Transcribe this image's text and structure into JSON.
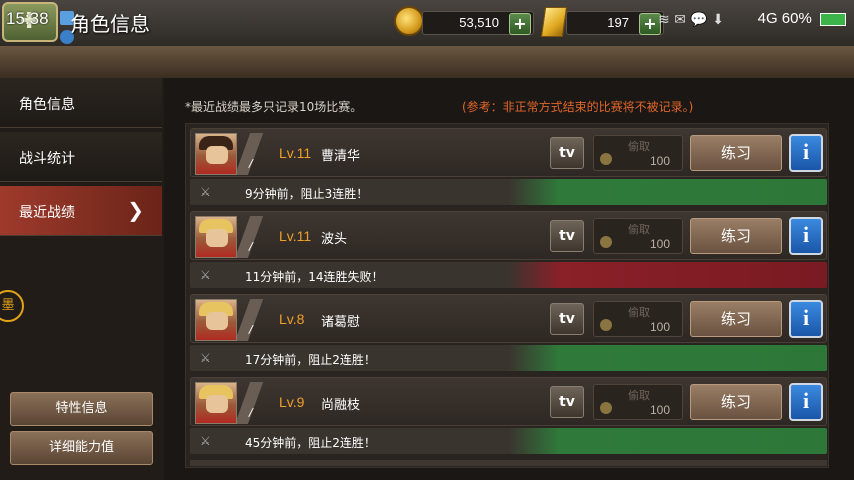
{
  "status_bar": {
    "time": "15:38",
    "battery_percent": "60%",
    "network": "4G"
  },
  "header": {
    "title": "角色信息",
    "back_icon": "back-arrow-icon",
    "coins": "53,510",
    "gold": "197",
    "plus_label": "+"
  },
  "sidebar": {
    "items": [
      {
        "label": "角色信息",
        "active": false
      },
      {
        "label": "战斗统计",
        "active": false
      },
      {
        "label": "最近战绩",
        "active": true
      }
    ],
    "chevron": "❯",
    "emblem_text": "墨",
    "buttons": [
      {
        "label": "特性信息"
      },
      {
        "label": "详细能力值"
      }
    ]
  },
  "notes": {
    "left": "*最近战绩最多只记录10场比赛。",
    "right": "(参考：非正常方式结束的比赛将不被记录。)"
  },
  "records": [
    {
      "level": "Lv.11",
      "name": "曹清华",
      "tv_label": "tv",
      "steal_label": "偷取",
      "steal_value": "100",
      "practice_label": "练习",
      "info_label": "i",
      "result_text": "9分钟前，阻止3连胜！",
      "outcome": "win"
    },
    {
      "level": "Lv.11",
      "name": "波头",
      "tv_label": "tv",
      "steal_label": "偷取",
      "steal_value": "100",
      "practice_label": "练习",
      "info_label": "i",
      "result_text": "11分钟前，14连胜失败！",
      "outcome": "lose"
    },
    {
      "level": "Lv.8",
      "name": "诸葛慰",
      "tv_label": "tv",
      "steal_label": "偷取",
      "steal_value": "100",
      "practice_label": "练习",
      "info_label": "i",
      "result_text": "17分钟前，阻止2连胜！",
      "outcome": "win"
    },
    {
      "level": "Lv.9",
      "name": "尚融枝",
      "tv_label": "tv",
      "steal_label": "偷取",
      "steal_value": "100",
      "practice_label": "练习",
      "info_label": "i",
      "result_text": "45分钟前，阻止2连胜！",
      "outcome": "win"
    }
  ],
  "colors": {
    "win": "#2d7838",
    "lose": "#7a1a22",
    "level_text": "#f0a028",
    "active_tab": "#9e3a2c",
    "note_warning": "#e0662a"
  }
}
